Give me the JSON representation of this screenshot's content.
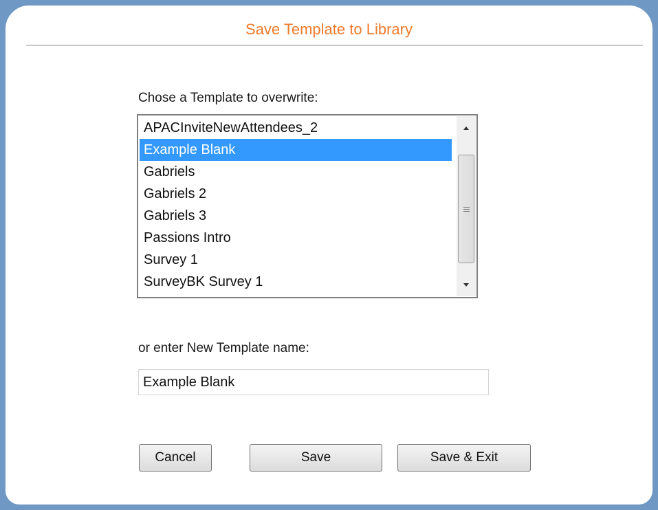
{
  "dialog": {
    "title": "Save Template to Library",
    "choose_label": "Chose a Template to overwrite:",
    "templates": [
      "APACInviteNewAttendees_2",
      "Example Blank",
      "Gabriels",
      "Gabriels 2",
      "Gabriels 3",
      "Passions Intro",
      "Survey 1",
      "SurveyBK Survey 1"
    ],
    "selected_template": "Example Blank",
    "new_name_label": "or enter New Template name:",
    "new_name_value": "Example Blank",
    "buttons": {
      "cancel": "Cancel",
      "save": "Save",
      "save_exit": "Save & Exit"
    }
  },
  "colors": {
    "title": "#f07a2c",
    "page_background": "#6f98c4",
    "selection": "#3399ff"
  }
}
